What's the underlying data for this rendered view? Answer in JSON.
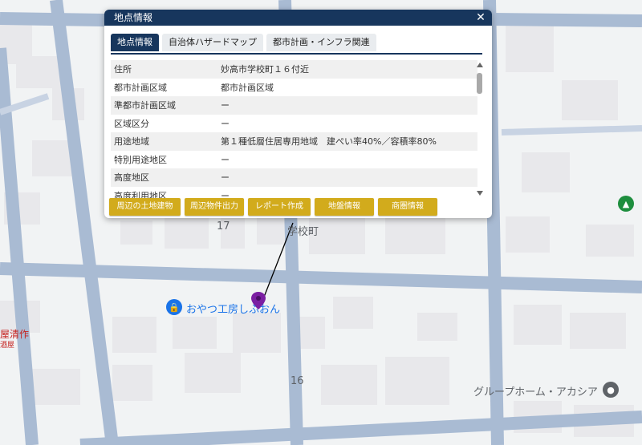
{
  "popup": {
    "title": "地点情報",
    "tabs": [
      {
        "label": "地点情報",
        "active": true
      },
      {
        "label": "自治体ハザードマップ",
        "active": false
      },
      {
        "label": "都市計画・インフラ関連",
        "active": false
      }
    ],
    "rows": [
      {
        "key": "住所",
        "value": "妙高市学校町１６付近"
      },
      {
        "key": "都市計画区域",
        "value": "都市計画区域"
      },
      {
        "key": "準都市計画区域",
        "value": "ー"
      },
      {
        "key": "区域区分",
        "value": "ー"
      },
      {
        "key": "用途地域",
        "value": "第１種低層住居専用地域　建ぺい率40%／容積率80%"
      },
      {
        "key": "特別用途地区",
        "value": "ー"
      },
      {
        "key": "高度地区",
        "value": "ー"
      },
      {
        "key": "高度利用地区",
        "value": "ー"
      }
    ],
    "buttons": [
      "周辺の土地建物",
      "周辺物件出力",
      "レポート作成",
      "地盤情報",
      "商圏情報"
    ]
  },
  "map": {
    "labels": {
      "area": "学校町",
      "block17": "17",
      "block16": "16",
      "poi1": "おやつ工房しふおん",
      "poi2": "グループホーム・アカシア",
      "poi3_line1": "屋清作",
      "poi3_line2": "酒屋"
    },
    "colors": {
      "road": "#a9bbd3",
      "building": "#e8e8eb",
      "pin": "#7b1fa2",
      "poi_blue": "#1a73e8",
      "poi_green": "#1e8e3e",
      "popup_header": "#17365d",
      "button": "#d2ab1c"
    }
  }
}
